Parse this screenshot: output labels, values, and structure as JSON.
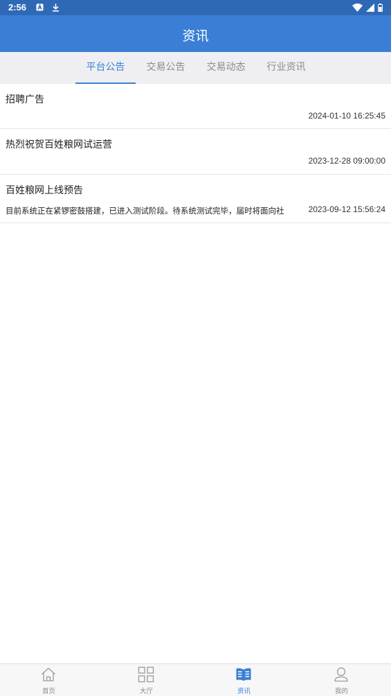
{
  "status_bar": {
    "time": "2:56",
    "left_icons": [
      "notification-a-icon",
      "download-icon"
    ],
    "right_icons": [
      "wifi-icon",
      "signal-icon",
      "battery-icon"
    ]
  },
  "header": {
    "title": "资讯"
  },
  "tabs": [
    {
      "label": "平台公告",
      "active": true
    },
    {
      "label": "交易公告",
      "active": false
    },
    {
      "label": "交易动态",
      "active": false
    },
    {
      "label": "行业资讯",
      "active": false
    }
  ],
  "news": [
    {
      "title": "招聘广告",
      "summary": "",
      "date": "2024-01-10 16:25:45"
    },
    {
      "title": "热烈祝贺百姓粮网试运营",
      "summary": "",
      "date": "2023-12-28 09:00:00"
    },
    {
      "title": "百姓粮网上线预告",
      "summary": "目前系统正在紧锣密鼓搭建，已进入测试阶段。待系统测试完毕，届时将面向社",
      "date": "2023-09-12 15:56:24"
    }
  ],
  "bottom_nav": [
    {
      "label": "首页",
      "icon": "home-icon",
      "active": false
    },
    {
      "label": "大厅",
      "icon": "grid-icon",
      "active": false
    },
    {
      "label": "资讯",
      "icon": "news-icon",
      "active": true
    },
    {
      "label": "我的",
      "icon": "user-icon",
      "active": false
    }
  ],
  "colors": {
    "status_bar": "#2f69b6",
    "primary": "#3a7fd5",
    "tab_bg": "#efeff3",
    "inactive_text": "#8a8a90"
  }
}
